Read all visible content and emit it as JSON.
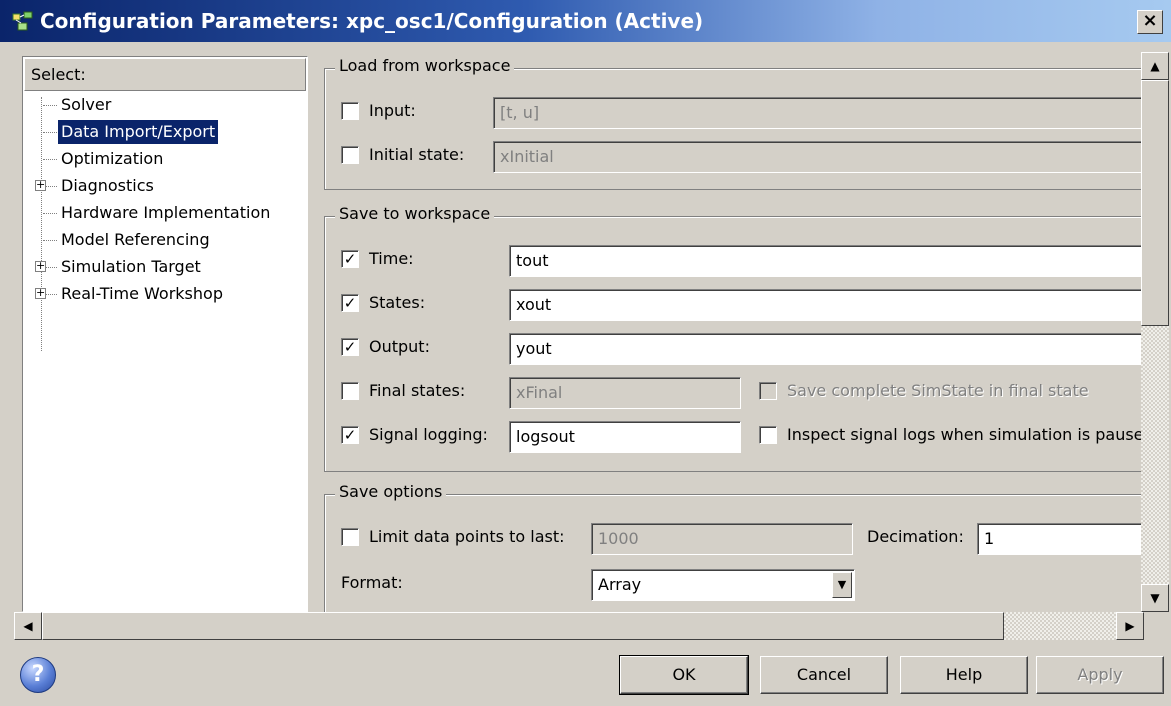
{
  "window": {
    "title": "Configuration Parameters: xpc_osc1/Configuration (Active)",
    "close": "×"
  },
  "tree": {
    "header": "Select:",
    "items": [
      {
        "label": "Solver",
        "expandable": false,
        "selected": false
      },
      {
        "label": "Data Import/Export",
        "expandable": false,
        "selected": true
      },
      {
        "label": "Optimization",
        "expandable": false,
        "selected": false
      },
      {
        "label": "Diagnostics",
        "expandable": true,
        "selected": false
      },
      {
        "label": "Hardware Implementation",
        "expandable": false,
        "selected": false
      },
      {
        "label": "Model Referencing",
        "expandable": false,
        "selected": false
      },
      {
        "label": "Simulation Target",
        "expandable": true,
        "selected": false
      },
      {
        "label": "Real-Time Workshop",
        "expandable": true,
        "selected": false
      }
    ],
    "expander_symbol": "+"
  },
  "load": {
    "legend": "Load from workspace",
    "input": {
      "label": "Input:",
      "checked": false,
      "value": "[t, u]"
    },
    "initial_state": {
      "label": "Initial state:",
      "checked": false,
      "value": "xInitial"
    }
  },
  "save": {
    "legend": "Save to workspace",
    "time": {
      "label": "Time:",
      "checked": true,
      "value": "tout"
    },
    "states": {
      "label": "States:",
      "checked": true,
      "value": "xout"
    },
    "output": {
      "label": "Output:",
      "checked": true,
      "value": "yout"
    },
    "final_states": {
      "label": "Final states:",
      "checked": false,
      "value": "xFinal"
    },
    "save_simstate": {
      "label": "Save complete SimState in final state",
      "checked": false
    },
    "signal_logging": {
      "label": "Signal logging:",
      "checked": true,
      "value": "logsout"
    },
    "inspect_logs": {
      "label": "Inspect signal logs when simulation is pause",
      "checked": false
    }
  },
  "options": {
    "legend": "Save options",
    "limit": {
      "label": "Limit data points to last:",
      "checked": false,
      "value": "1000"
    },
    "decimation": {
      "label": "Decimation:",
      "value": "1"
    },
    "format": {
      "label": "Format:",
      "value": "Array"
    }
  },
  "checkmark": "✓",
  "buttons": {
    "help_icon": "?",
    "ok": "OK",
    "cancel": "Cancel",
    "help": "Help",
    "apply": "Apply"
  },
  "icons": {
    "scroll_up": "▲",
    "scroll_down": "▼",
    "scroll_left": "◀",
    "scroll_right": "▶",
    "dropdown": "▼"
  }
}
